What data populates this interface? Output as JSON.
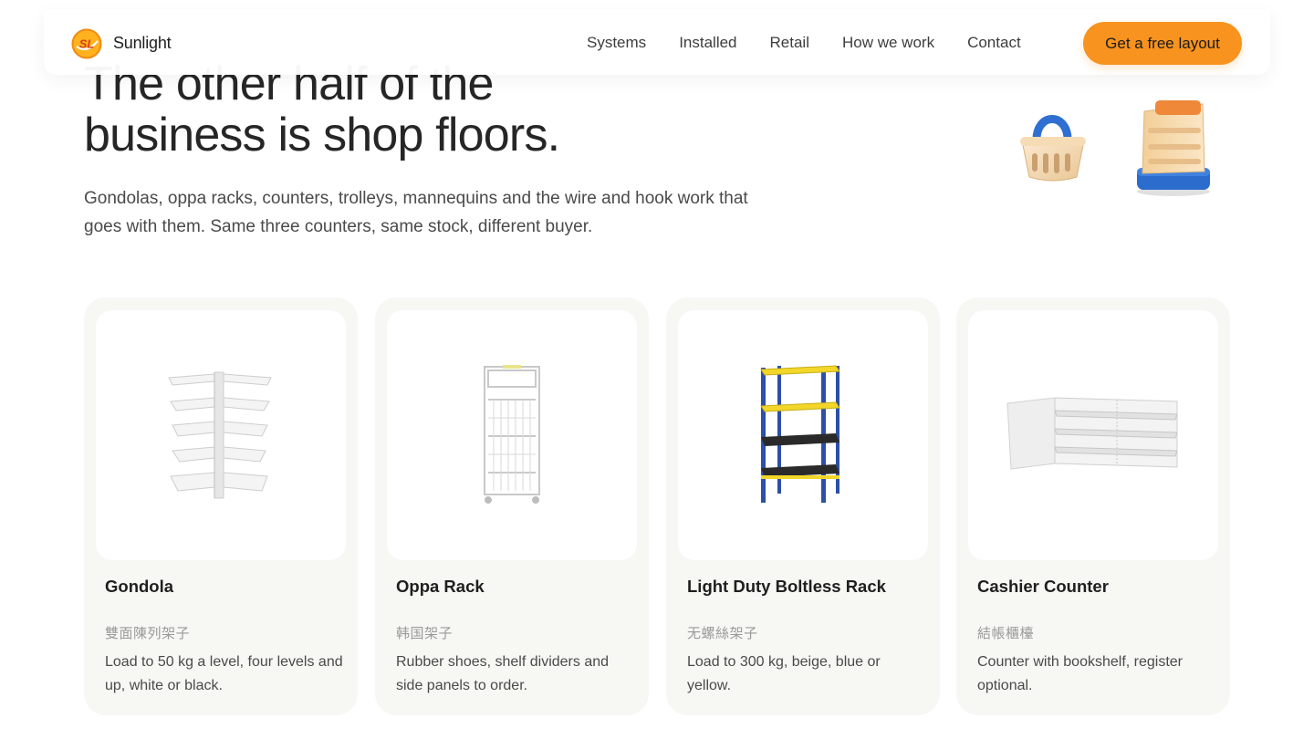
{
  "brand": {
    "name": "Sunlight",
    "logo_text": "SL",
    "accent": "#f7931e"
  },
  "nav": {
    "links": [
      "Systems",
      "Installed",
      "Retail",
      "How we work",
      "Contact"
    ],
    "cta_label": "Get a free layout"
  },
  "hero": {
    "title_line1": "The other half of the",
    "title_line2": "business is shop floors.",
    "subtitle": "Gondolas, oppa racks, counters, trolleys, mannequins and the wire and hook work that goes with them. Same three counters, same stock, different buyer."
  },
  "decor": {
    "icons": [
      "shopping-basket-icon",
      "display-shelf-icon"
    ]
  },
  "products": [
    {
      "name": "Gondola",
      "zh": "雙面陳列架子",
      "desc": "Load to 50 kg a level, four levels and up, white or black.",
      "image": "gondola-shelf"
    },
    {
      "name": "Oppa Rack",
      "zh": "韩国架子",
      "desc": "Rubber shoes, shelf dividers and side panels to order.",
      "image": "wire-rack"
    },
    {
      "name": "Light Duty Boltless Rack",
      "zh": "无螺絲架子",
      "desc": "Load to 300 kg, beige, blue or yellow.",
      "image": "boltless-rack"
    },
    {
      "name": "Cashier Counter",
      "zh": "結帳櫃檯",
      "desc": "Counter with bookshelf, register optional.",
      "image": "cashier-counter"
    }
  ]
}
